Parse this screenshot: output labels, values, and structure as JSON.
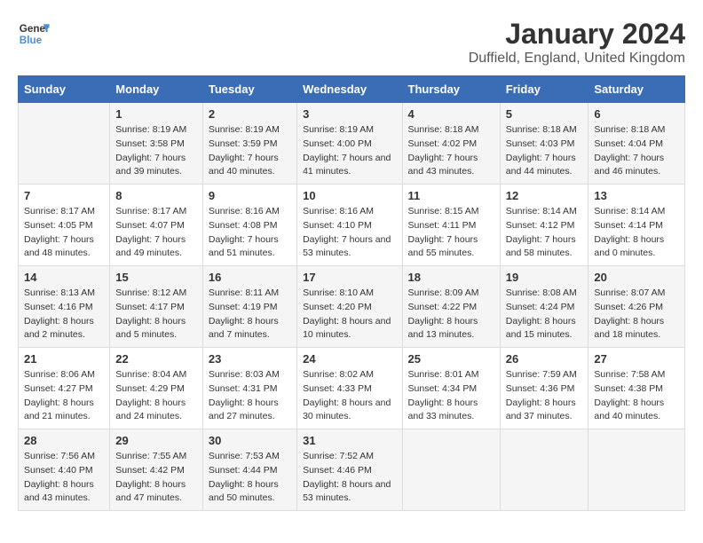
{
  "header": {
    "logo_general": "General",
    "logo_blue": "Blue",
    "month_title": "January 2024",
    "location": "Duffield, England, United Kingdom"
  },
  "days_of_week": [
    "Sunday",
    "Monday",
    "Tuesday",
    "Wednesday",
    "Thursday",
    "Friday",
    "Saturday"
  ],
  "weeks": [
    [
      {
        "day": "",
        "sunrise": "",
        "sunset": "",
        "daylight": ""
      },
      {
        "day": "1",
        "sunrise": "Sunrise: 8:19 AM",
        "sunset": "Sunset: 3:58 PM",
        "daylight": "Daylight: 7 hours and 39 minutes."
      },
      {
        "day": "2",
        "sunrise": "Sunrise: 8:19 AM",
        "sunset": "Sunset: 3:59 PM",
        "daylight": "Daylight: 7 hours and 40 minutes."
      },
      {
        "day": "3",
        "sunrise": "Sunrise: 8:19 AM",
        "sunset": "Sunset: 4:00 PM",
        "daylight": "Daylight: 7 hours and 41 minutes."
      },
      {
        "day": "4",
        "sunrise": "Sunrise: 8:18 AM",
        "sunset": "Sunset: 4:02 PM",
        "daylight": "Daylight: 7 hours and 43 minutes."
      },
      {
        "day": "5",
        "sunrise": "Sunrise: 8:18 AM",
        "sunset": "Sunset: 4:03 PM",
        "daylight": "Daylight: 7 hours and 44 minutes."
      },
      {
        "day": "6",
        "sunrise": "Sunrise: 8:18 AM",
        "sunset": "Sunset: 4:04 PM",
        "daylight": "Daylight: 7 hours and 46 minutes."
      }
    ],
    [
      {
        "day": "7",
        "sunrise": "Sunrise: 8:17 AM",
        "sunset": "Sunset: 4:05 PM",
        "daylight": "Daylight: 7 hours and 48 minutes."
      },
      {
        "day": "8",
        "sunrise": "Sunrise: 8:17 AM",
        "sunset": "Sunset: 4:07 PM",
        "daylight": "Daylight: 7 hours and 49 minutes."
      },
      {
        "day": "9",
        "sunrise": "Sunrise: 8:16 AM",
        "sunset": "Sunset: 4:08 PM",
        "daylight": "Daylight: 7 hours and 51 minutes."
      },
      {
        "day": "10",
        "sunrise": "Sunrise: 8:16 AM",
        "sunset": "Sunset: 4:10 PM",
        "daylight": "Daylight: 7 hours and 53 minutes."
      },
      {
        "day": "11",
        "sunrise": "Sunrise: 8:15 AM",
        "sunset": "Sunset: 4:11 PM",
        "daylight": "Daylight: 7 hours and 55 minutes."
      },
      {
        "day": "12",
        "sunrise": "Sunrise: 8:14 AM",
        "sunset": "Sunset: 4:12 PM",
        "daylight": "Daylight: 7 hours and 58 minutes."
      },
      {
        "day": "13",
        "sunrise": "Sunrise: 8:14 AM",
        "sunset": "Sunset: 4:14 PM",
        "daylight": "Daylight: 8 hours and 0 minutes."
      }
    ],
    [
      {
        "day": "14",
        "sunrise": "Sunrise: 8:13 AM",
        "sunset": "Sunset: 4:16 PM",
        "daylight": "Daylight: 8 hours and 2 minutes."
      },
      {
        "day": "15",
        "sunrise": "Sunrise: 8:12 AM",
        "sunset": "Sunset: 4:17 PM",
        "daylight": "Daylight: 8 hours and 5 minutes."
      },
      {
        "day": "16",
        "sunrise": "Sunrise: 8:11 AM",
        "sunset": "Sunset: 4:19 PM",
        "daylight": "Daylight: 8 hours and 7 minutes."
      },
      {
        "day": "17",
        "sunrise": "Sunrise: 8:10 AM",
        "sunset": "Sunset: 4:20 PM",
        "daylight": "Daylight: 8 hours and 10 minutes."
      },
      {
        "day": "18",
        "sunrise": "Sunrise: 8:09 AM",
        "sunset": "Sunset: 4:22 PM",
        "daylight": "Daylight: 8 hours and 13 minutes."
      },
      {
        "day": "19",
        "sunrise": "Sunrise: 8:08 AM",
        "sunset": "Sunset: 4:24 PM",
        "daylight": "Daylight: 8 hours and 15 minutes."
      },
      {
        "day": "20",
        "sunrise": "Sunrise: 8:07 AM",
        "sunset": "Sunset: 4:26 PM",
        "daylight": "Daylight: 8 hours and 18 minutes."
      }
    ],
    [
      {
        "day": "21",
        "sunrise": "Sunrise: 8:06 AM",
        "sunset": "Sunset: 4:27 PM",
        "daylight": "Daylight: 8 hours and 21 minutes."
      },
      {
        "day": "22",
        "sunrise": "Sunrise: 8:04 AM",
        "sunset": "Sunset: 4:29 PM",
        "daylight": "Daylight: 8 hours and 24 minutes."
      },
      {
        "day": "23",
        "sunrise": "Sunrise: 8:03 AM",
        "sunset": "Sunset: 4:31 PM",
        "daylight": "Daylight: 8 hours and 27 minutes."
      },
      {
        "day": "24",
        "sunrise": "Sunrise: 8:02 AM",
        "sunset": "Sunset: 4:33 PM",
        "daylight": "Daylight: 8 hours and 30 minutes."
      },
      {
        "day": "25",
        "sunrise": "Sunrise: 8:01 AM",
        "sunset": "Sunset: 4:34 PM",
        "daylight": "Daylight: 8 hours and 33 minutes."
      },
      {
        "day": "26",
        "sunrise": "Sunrise: 7:59 AM",
        "sunset": "Sunset: 4:36 PM",
        "daylight": "Daylight: 8 hours and 37 minutes."
      },
      {
        "day": "27",
        "sunrise": "Sunrise: 7:58 AM",
        "sunset": "Sunset: 4:38 PM",
        "daylight": "Daylight: 8 hours and 40 minutes."
      }
    ],
    [
      {
        "day": "28",
        "sunrise": "Sunrise: 7:56 AM",
        "sunset": "Sunset: 4:40 PM",
        "daylight": "Daylight: 8 hours and 43 minutes."
      },
      {
        "day": "29",
        "sunrise": "Sunrise: 7:55 AM",
        "sunset": "Sunset: 4:42 PM",
        "daylight": "Daylight: 8 hours and 47 minutes."
      },
      {
        "day": "30",
        "sunrise": "Sunrise: 7:53 AM",
        "sunset": "Sunset: 4:44 PM",
        "daylight": "Daylight: 8 hours and 50 minutes."
      },
      {
        "day": "31",
        "sunrise": "Sunrise: 7:52 AM",
        "sunset": "Sunset: 4:46 PM",
        "daylight": "Daylight: 8 hours and 53 minutes."
      },
      {
        "day": "",
        "sunrise": "",
        "sunset": "",
        "daylight": ""
      },
      {
        "day": "",
        "sunrise": "",
        "sunset": "",
        "daylight": ""
      },
      {
        "day": "",
        "sunrise": "",
        "sunset": "",
        "daylight": ""
      }
    ]
  ]
}
